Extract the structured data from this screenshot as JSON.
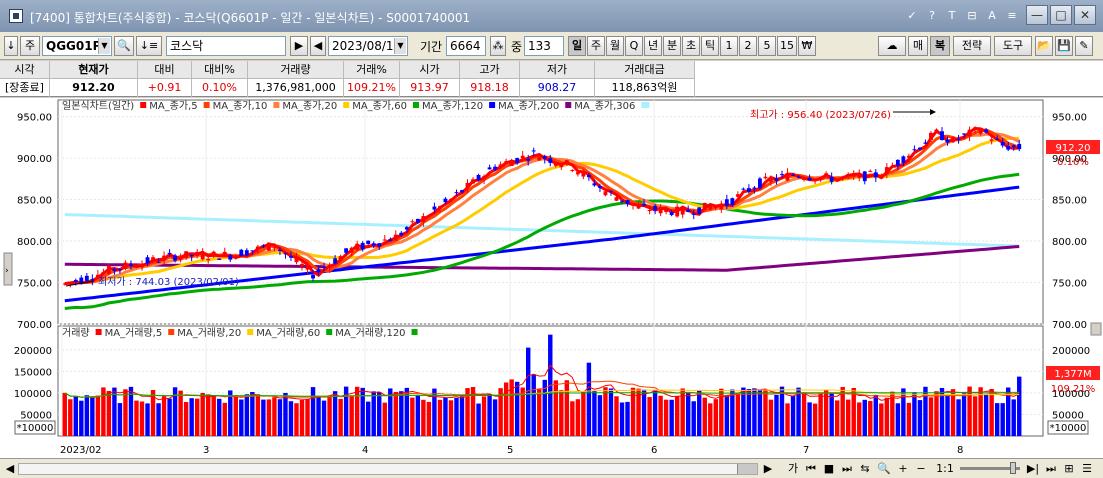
{
  "window": {
    "title": "[7400] 통합차트(주식종합) - 코스닥(Q6601P - 일간 - 일본식차트) - S0001740001",
    "title_buttons": [
      "✓",
      "?",
      "T",
      "⊟",
      "A",
      "≡"
    ],
    "minimize": "—",
    "maximize": "□",
    "close": "✕"
  },
  "toolbar": {
    "down_arrow": "↓",
    "type_select": "주",
    "code": "QGG01P",
    "search_glyph": "🔍",
    "sort_glyph": "↓≡",
    "name": "코스닥",
    "play": "▶",
    "back": "◀",
    "date": "2023/08/11",
    "period_label": "기간",
    "period_value": "6664",
    "zoom_label": "중",
    "zoom_value": "133",
    "period_buttons": [
      "일",
      "주",
      "월",
      "Q",
      "년",
      "분",
      "초",
      "틱",
      "1",
      "2",
      "5",
      "15",
      "₩"
    ],
    "right_buttons": [
      "☁",
      "매",
      "복",
      "전략",
      "도구",
      "📂",
      "💾",
      "✎"
    ]
  },
  "quote": {
    "headers": [
      "시각",
      "현재가",
      "대비",
      "대비%",
      "거래량",
      "거래%",
      "시가",
      "고가",
      "저가",
      "거래대금"
    ],
    "values": [
      "[장종료]",
      "912.20",
      "+0.91",
      "0.10%",
      "1,376,981,000",
      "109.21%",
      "913.97",
      "918.18",
      "908.27",
      "118,863억원"
    ]
  },
  "price_legend": [
    {
      "text": "일본식차트(일간)",
      "color": "#1a1a1a"
    },
    {
      "text": "MA_종가,5",
      "color": "#ff0000"
    },
    {
      "text": "MA_종가,10",
      "color": "#ff4000"
    },
    {
      "text": "MA_종가,20",
      "color": "#ff8040"
    },
    {
      "text": "MA_종가,60",
      "color": "#ffcc00"
    },
    {
      "text": "MA_종가,120",
      "color": "#00aa00"
    },
    {
      "text": "MA_종가,200",
      "color": "#0000ff"
    },
    {
      "text": "MA_종가,306",
      "color": "#800080"
    }
  ],
  "volume_legend": [
    {
      "text": "거래량",
      "color": "#ff0000"
    },
    {
      "text": "MA_거래량,5",
      "color": "#ff0000"
    },
    {
      "text": "MA_거래량,20",
      "color": "#ff4000"
    },
    {
      "text": "MA_거래량,60",
      "color": "#ffcc00"
    },
    {
      "text": "MA_거래량,120",
      "color": "#00aa00"
    }
  ],
  "annotations": {
    "high": "최고가 : 956.40 (2023/07/26)",
    "low": "최저가 : 744.03 (2023/02/01)"
  },
  "price_axis": {
    "ticks": [
      "950.00",
      "900.00",
      "850.00",
      "800.00",
      "750.00",
      "700.00"
    ],
    "current": "912.20",
    "current_pct": "0.10%"
  },
  "volume_axis": {
    "ticks": [
      "200000",
      "150000",
      "100000",
      "50000"
    ],
    "unit": "*10000",
    "current": "1,377M",
    "current_pct": "109.21%"
  },
  "x_axis": {
    "labels": [
      "2023/02",
      "3",
      "4",
      "5",
      "6",
      "7",
      "8"
    ]
  },
  "bottom": {
    "buttons": [
      "◀",
      "▶",
      "가",
      "⏮",
      "■",
      "⏭",
      "⇆",
      "🔍",
      "+",
      "−",
      "1:1",
      "▶|",
      "⏭",
      "⊞",
      "☰"
    ]
  },
  "colors": {
    "up": "#ff0000",
    "down": "#0000ff",
    "ma5": "#ff0000",
    "ma10": "#ff4000",
    "ma20": "#ff8040",
    "ma60": "#ffcc00",
    "ma120": "#00aa00",
    "ma200": "#0000ff",
    "ma306": "#800080",
    "baseline": "#a8f0ff"
  }
}
